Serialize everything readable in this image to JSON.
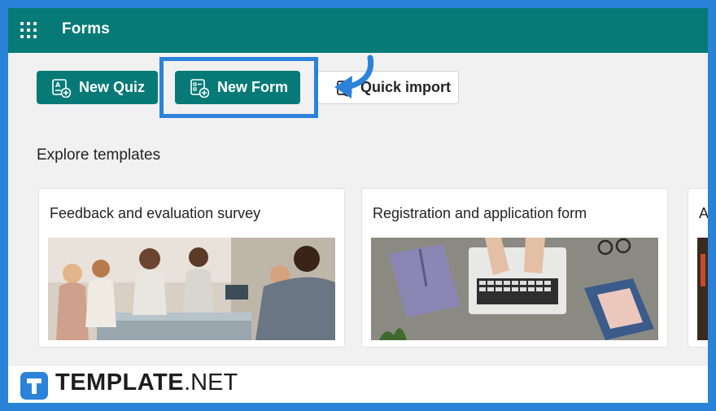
{
  "header": {
    "title": "Forms",
    "waffle_icon": "app-launcher-icon"
  },
  "actions": {
    "new_quiz": "New Quiz",
    "new_form": "New Form",
    "quick_import": "Quick import"
  },
  "templates": {
    "section_title": "Explore templates",
    "cards": [
      {
        "title": "Feedback and evaluation survey",
        "image": "people-meeting-photo"
      },
      {
        "title": "Registration and application form",
        "image": "laptop-typing-photo"
      },
      {
        "title": "A",
        "image": "partial-photo"
      }
    ]
  },
  "watermark": {
    "brand_bold": "TEMPLATE",
    "brand_light": ".NET"
  },
  "colors": {
    "accent": "#077a77",
    "annotation": "#2b82d9",
    "background": "#f1f1f1"
  }
}
